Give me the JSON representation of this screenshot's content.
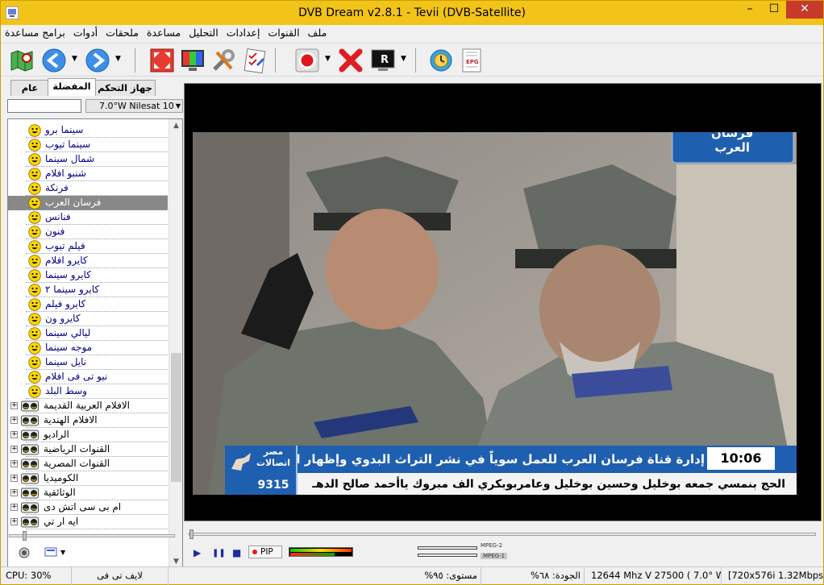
{
  "window": {
    "title": "DVB Dream v2.8.1 - Tevii (DVB-Satellite)",
    "minimize_label": "–",
    "maximize_label": "☐",
    "close_label": "✕"
  },
  "menu": [
    "ملف",
    "القنوات",
    "إعدادات",
    "التحليل",
    "مساعدة",
    "ملحقات",
    "أدوات",
    "برامج مساعدة"
  ],
  "toolbar": {
    "record_menu_arrow": "▼",
    "back_menu_arrow": "▼",
    "forward_menu_arrow": "▼",
    "r_menu_arrow": "▼",
    "r_label": "R",
    "epg_label": "EPG"
  },
  "left_panel": {
    "tabs": [
      "عام",
      "المفضلة",
      "جهاز التحكم"
    ],
    "active_tab": "المفضلة",
    "filter_value": "",
    "satellite": "7.0°W Nilesat 10",
    "channels": [
      "سينما برو",
      "سينما تيوب",
      "شمال سينما",
      "شنبو افلام",
      "فرنكة",
      "فرسان العرب",
      "فنانس",
      "فنون",
      "فيلم تيوب",
      "كايرو افلام",
      "كايرو سينما",
      "كايرو سينما ٢",
      "كايرو فيلم",
      "كايرو ون",
      "ليالي سينما",
      "موجه سينما",
      "نايل سينما",
      "نيو تى فى افلام",
      "وسط البلد"
    ],
    "selected_channel": "فرسان العرب",
    "groups": [
      "الافلام العربية القديمة",
      "الافلام الهندية",
      "الراديو",
      "القنوات الرياضية",
      "القنوات المصرية",
      "الكوميديا",
      "الوثائقية",
      "ام بى سى اتش دى",
      "ايه ار تي"
    ],
    "expander_label": "+",
    "scroll_up": "▲",
    "scroll_down": "▼"
  },
  "video": {
    "channel_logo_line1": "فرسان",
    "channel_logo_line2": "العرب",
    "ticker_time": "10:06 AM",
    "ticker_line1": "إدارة قناة فرسان العرب للعمل سوياً في نشر التراث البدوي وإظهار الوجه",
    "ticker_line2": "الحج بنمسي جمعه بوخليل وحسين بوخليل وعامربوبكري الف مبروك ياأحمد صالح الدهـ",
    "contact_line1": "مصر",
    "contact_line2": "اتصالات",
    "contact_number": "9315"
  },
  "controls": {
    "play": "▶",
    "pause": "❚❚",
    "stop": "■",
    "pip_label": "PIP",
    "codec_video": "MPEG-2",
    "codec_audio": "MPEG-1",
    "audio_level_1": 0.97,
    "audio_level_2": 0.7
  },
  "status": {
    "cpu": "CPU: 30%",
    "channel": "لايف تى فى",
    "level": "مستوى: ٩٥%",
    "quality": "الجودة: ٦٨%",
    "frequency": "12644 Mhz  V  27500  ( 7.0° W)",
    "resolution": "[720x576i  1.32Mbps]"
  },
  "colors": {
    "titlebar": "#f2c318",
    "close_button": "#c7392a",
    "channel_text": "#00008b",
    "selected_row": "#888888",
    "ticker_blue": "#1f5fb0"
  }
}
